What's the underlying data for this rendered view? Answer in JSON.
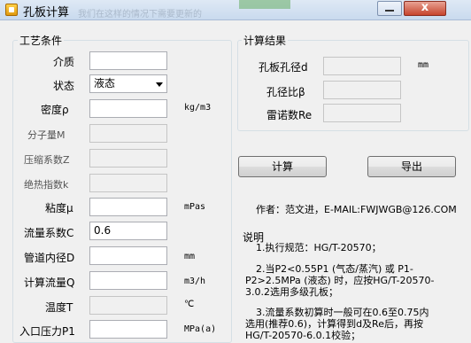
{
  "window": {
    "title": "孔板计算",
    "ghost_title": "我们在这样的情况下需要更新的",
    "close_glyph": "x"
  },
  "process": {
    "group_title": "工艺条件",
    "fields": {
      "medium_label": "介质",
      "medium_value": "",
      "state_label": "状态",
      "state_value": "液态",
      "density_label": "密度ρ",
      "density_value": "",
      "density_unit": "kg/m3",
      "mw_label": "分子量M",
      "z_label": "压缩系数Z",
      "k_label": "绝热指数k",
      "viscosity_label": "粘度μ",
      "viscosity_value": "",
      "viscosity_unit": "mPas",
      "c_label": "流量系数C",
      "c_value": "0.6",
      "d_label": "管道内径D",
      "d_value": "",
      "d_unit": "mm",
      "q_label": "计算流量Q",
      "q_value": "",
      "q_unit": "m3/h",
      "t_label": "温度T",
      "t_value": "",
      "t_unit": "℃",
      "p1_label": "入口压力P1",
      "p1_value": "",
      "p1_unit": "MPa(a)"
    }
  },
  "results": {
    "group_title": "计算结果",
    "orifice_d_label": "孔板孔径d",
    "orifice_d_value": "",
    "orifice_d_unit": "mm",
    "beta_label": "孔径比β",
    "beta_value": "",
    "re_label": "雷诺数Re",
    "re_value": ""
  },
  "actions": {
    "calculate_label": "计算",
    "export_label": "导出"
  },
  "author": "作者：范文进，E-MAIL:FWJWGB@126.COM",
  "notes": {
    "title": "说明",
    "lines": [
      "1.执行规范：HG/T-20570；",
      "2.当P2<0.55P1 (气态/蒸汽) 或 P1-",
      "P2>2.5MPa (液态) 时，应按HG/T-20570-",
      "3.0.2选用多级孔板；",
      "3.流量系数初算时一般可在0.6至0.75内",
      "选用(推荐0.6)，计算得到d及Re后，再按",
      "HG/T-20570-6.0.1校验；"
    ]
  }
}
